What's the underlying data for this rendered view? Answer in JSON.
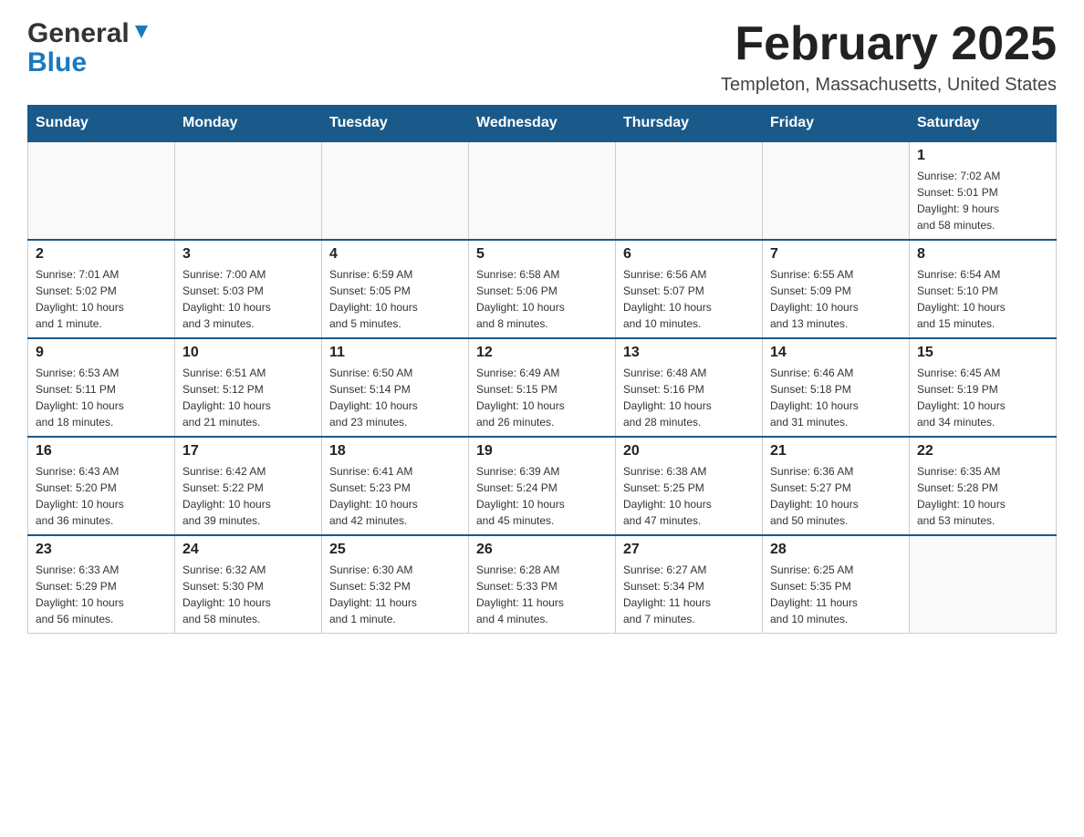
{
  "logo": {
    "general": "General",
    "blue": "Blue"
  },
  "title": "February 2025",
  "location": "Templeton, Massachusetts, United States",
  "days_header": [
    "Sunday",
    "Monday",
    "Tuesday",
    "Wednesday",
    "Thursday",
    "Friday",
    "Saturday"
  ],
  "weeks": [
    {
      "days": [
        {
          "date": "",
          "info": ""
        },
        {
          "date": "",
          "info": ""
        },
        {
          "date": "",
          "info": ""
        },
        {
          "date": "",
          "info": ""
        },
        {
          "date": "",
          "info": ""
        },
        {
          "date": "",
          "info": ""
        },
        {
          "date": "1",
          "info": "Sunrise: 7:02 AM\nSunset: 5:01 PM\nDaylight: 9 hours\nand 58 minutes."
        }
      ]
    },
    {
      "days": [
        {
          "date": "2",
          "info": "Sunrise: 7:01 AM\nSunset: 5:02 PM\nDaylight: 10 hours\nand 1 minute."
        },
        {
          "date": "3",
          "info": "Sunrise: 7:00 AM\nSunset: 5:03 PM\nDaylight: 10 hours\nand 3 minutes."
        },
        {
          "date": "4",
          "info": "Sunrise: 6:59 AM\nSunset: 5:05 PM\nDaylight: 10 hours\nand 5 minutes."
        },
        {
          "date": "5",
          "info": "Sunrise: 6:58 AM\nSunset: 5:06 PM\nDaylight: 10 hours\nand 8 minutes."
        },
        {
          "date": "6",
          "info": "Sunrise: 6:56 AM\nSunset: 5:07 PM\nDaylight: 10 hours\nand 10 minutes."
        },
        {
          "date": "7",
          "info": "Sunrise: 6:55 AM\nSunset: 5:09 PM\nDaylight: 10 hours\nand 13 minutes."
        },
        {
          "date": "8",
          "info": "Sunrise: 6:54 AM\nSunset: 5:10 PM\nDaylight: 10 hours\nand 15 minutes."
        }
      ]
    },
    {
      "days": [
        {
          "date": "9",
          "info": "Sunrise: 6:53 AM\nSunset: 5:11 PM\nDaylight: 10 hours\nand 18 minutes."
        },
        {
          "date": "10",
          "info": "Sunrise: 6:51 AM\nSunset: 5:12 PM\nDaylight: 10 hours\nand 21 minutes."
        },
        {
          "date": "11",
          "info": "Sunrise: 6:50 AM\nSunset: 5:14 PM\nDaylight: 10 hours\nand 23 minutes."
        },
        {
          "date": "12",
          "info": "Sunrise: 6:49 AM\nSunset: 5:15 PM\nDaylight: 10 hours\nand 26 minutes."
        },
        {
          "date": "13",
          "info": "Sunrise: 6:48 AM\nSunset: 5:16 PM\nDaylight: 10 hours\nand 28 minutes."
        },
        {
          "date": "14",
          "info": "Sunrise: 6:46 AM\nSunset: 5:18 PM\nDaylight: 10 hours\nand 31 minutes."
        },
        {
          "date": "15",
          "info": "Sunrise: 6:45 AM\nSunset: 5:19 PM\nDaylight: 10 hours\nand 34 minutes."
        }
      ]
    },
    {
      "days": [
        {
          "date": "16",
          "info": "Sunrise: 6:43 AM\nSunset: 5:20 PM\nDaylight: 10 hours\nand 36 minutes."
        },
        {
          "date": "17",
          "info": "Sunrise: 6:42 AM\nSunset: 5:22 PM\nDaylight: 10 hours\nand 39 minutes."
        },
        {
          "date": "18",
          "info": "Sunrise: 6:41 AM\nSunset: 5:23 PM\nDaylight: 10 hours\nand 42 minutes."
        },
        {
          "date": "19",
          "info": "Sunrise: 6:39 AM\nSunset: 5:24 PM\nDaylight: 10 hours\nand 45 minutes."
        },
        {
          "date": "20",
          "info": "Sunrise: 6:38 AM\nSunset: 5:25 PM\nDaylight: 10 hours\nand 47 minutes."
        },
        {
          "date": "21",
          "info": "Sunrise: 6:36 AM\nSunset: 5:27 PM\nDaylight: 10 hours\nand 50 minutes."
        },
        {
          "date": "22",
          "info": "Sunrise: 6:35 AM\nSunset: 5:28 PM\nDaylight: 10 hours\nand 53 minutes."
        }
      ]
    },
    {
      "days": [
        {
          "date": "23",
          "info": "Sunrise: 6:33 AM\nSunset: 5:29 PM\nDaylight: 10 hours\nand 56 minutes."
        },
        {
          "date": "24",
          "info": "Sunrise: 6:32 AM\nSunset: 5:30 PM\nDaylight: 10 hours\nand 58 minutes."
        },
        {
          "date": "25",
          "info": "Sunrise: 6:30 AM\nSunset: 5:32 PM\nDaylight: 11 hours\nand 1 minute."
        },
        {
          "date": "26",
          "info": "Sunrise: 6:28 AM\nSunset: 5:33 PM\nDaylight: 11 hours\nand 4 minutes."
        },
        {
          "date": "27",
          "info": "Sunrise: 6:27 AM\nSunset: 5:34 PM\nDaylight: 11 hours\nand 7 minutes."
        },
        {
          "date": "28",
          "info": "Sunrise: 6:25 AM\nSunset: 5:35 PM\nDaylight: 11 hours\nand 10 minutes."
        },
        {
          "date": "",
          "info": ""
        }
      ]
    }
  ]
}
